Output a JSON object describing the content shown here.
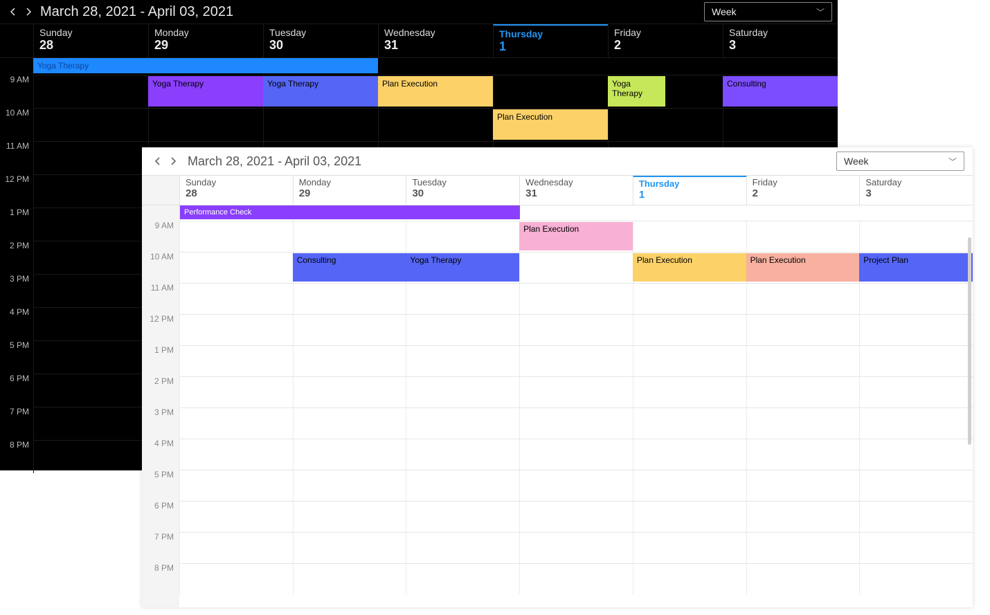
{
  "hours": [
    "9 AM",
    "10 AM",
    "11 AM",
    "12 PM",
    "1 PM",
    "2 PM",
    "3 PM",
    "4 PM",
    "5 PM",
    "6 PM",
    "7 PM",
    "8 PM"
  ],
  "days": [
    {
      "name": "Sunday",
      "num": "28",
      "today": false
    },
    {
      "name": "Monday",
      "num": "29",
      "today": false
    },
    {
      "name": "Tuesday",
      "num": "30",
      "today": false
    },
    {
      "name": "Wednesday",
      "num": "31",
      "today": false
    },
    {
      "name": "Thursday",
      "num": "1",
      "today": true
    },
    {
      "name": "Friday",
      "num": "2",
      "today": false
    },
    {
      "name": "Saturday",
      "num": "3",
      "today": false
    }
  ],
  "dark": {
    "range": "March 28, 2021 - April 03, 2021",
    "view": "Week",
    "allday": [
      {
        "title": "Yoga Therapy",
        "startDay": 0,
        "spanDays": 3,
        "cls": "c-blue"
      }
    ],
    "events": [
      {
        "title": "Yoga Therapy",
        "day": 1,
        "hour": 0,
        "cls": "c-purple"
      },
      {
        "title": "Yoga Therapy",
        "day": 2,
        "hour": 0,
        "cls": "c-indigo"
      },
      {
        "title": "Plan Execution",
        "day": 3,
        "hour": 0,
        "cls": "c-amber"
      },
      {
        "title": "Plan Execution",
        "day": 4,
        "hour": 1,
        "cls": "c-amber"
      },
      {
        "title": "Yoga Therapy",
        "day": 5,
        "hour": 0,
        "cls": "c-lime",
        "half": true
      },
      {
        "title": "Consulting",
        "day": 6,
        "hour": 0,
        "cls": "c-violet"
      }
    ]
  },
  "light": {
    "range": "March 28, 2021 - April 03, 2021",
    "view": "Week",
    "allday": [
      {
        "title": "Performance Check",
        "startDay": 0,
        "spanDays": 3,
        "cls": "c-purple"
      }
    ],
    "events": [
      {
        "title": "Plan Execution",
        "day": 3,
        "hour": 0,
        "cls": "c-pink"
      },
      {
        "title": "Consulting",
        "day": 1,
        "hour": 1,
        "cls": "c-indigo"
      },
      {
        "title": "Yoga Therapy",
        "day": 2,
        "hour": 1,
        "cls": "c-indigo"
      },
      {
        "title": "Plan Execution",
        "day": 4,
        "hour": 1,
        "cls": "c-amber"
      },
      {
        "title": "Plan Execution",
        "day": 5,
        "hour": 1,
        "cls": "c-salmon"
      },
      {
        "title": "Project Plan",
        "day": 6,
        "hour": 1,
        "cls": "c-indigo"
      }
    ]
  }
}
